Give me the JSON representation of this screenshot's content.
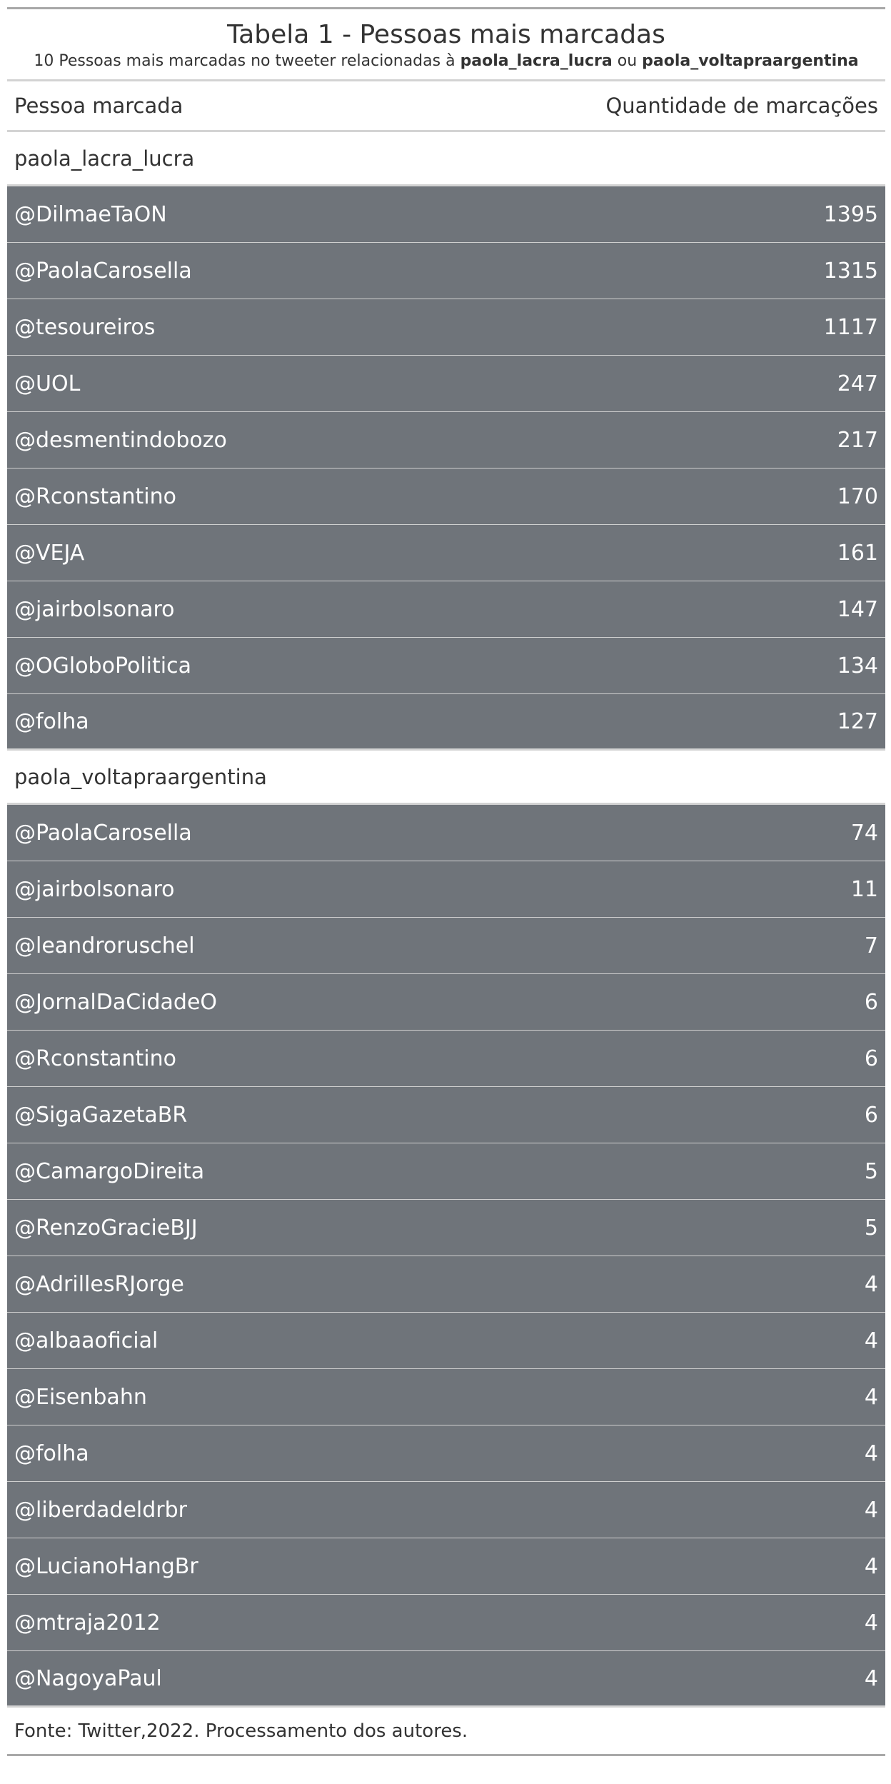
{
  "table": {
    "title": "Tabela 1 - Pessoas mais marcadas",
    "subtitle_prefix": "10 Pessoas mais marcadas no tweeter relacionadas à ",
    "subtitle_bold_1": "paola_lacra_lucra",
    "subtitle_mid": " ou ",
    "subtitle_bold_2": "paola_voltapraargentina",
    "col_person": "Pessoa marcada",
    "col_count": "Quantidade de marcações",
    "source": "Fonte: Twitter,2022. Processamento dos autores."
  },
  "colors": {
    "row_bg": "#6f747a",
    "row_text": "#ffffff",
    "text": "#333333"
  },
  "chart_data": {
    "type": "table",
    "title": "Tabela 1 - Pessoas mais marcadas",
    "columns": [
      "Pessoa marcada",
      "Quantidade de marcações"
    ],
    "groups": [
      {
        "name": "paola_lacra_lucra",
        "rows": [
          {
            "person": "@DilmaeTaON",
            "count": 1395
          },
          {
            "person": "@PaolaCarosella",
            "count": 1315
          },
          {
            "person": "@tesoureiros",
            "count": 1117
          },
          {
            "person": "@UOL",
            "count": 247
          },
          {
            "person": "@desmentindobozo",
            "count": 217
          },
          {
            "person": "@Rconstantino",
            "count": 170
          },
          {
            "person": "@VEJA",
            "count": 161
          },
          {
            "person": "@jairbolsonaro",
            "count": 147
          },
          {
            "person": "@OGloboPolitica",
            "count": 134
          },
          {
            "person": "@folha",
            "count": 127
          }
        ]
      },
      {
        "name": "paola_voltapraargentina",
        "rows": [
          {
            "person": "@PaolaCarosella",
            "count": 74
          },
          {
            "person": "@jairbolsonaro",
            "count": 11
          },
          {
            "person": "@leandroruschel",
            "count": 7
          },
          {
            "person": "@JornalDaCidadeO",
            "count": 6
          },
          {
            "person": "@Rconstantino",
            "count": 6
          },
          {
            "person": "@SigaGazetaBR",
            "count": 6
          },
          {
            "person": "@CamargoDireita",
            "count": 5
          },
          {
            "person": "@RenzoGracieBJJ",
            "count": 5
          },
          {
            "person": "@AdrillesRJorge",
            "count": 4
          },
          {
            "person": "@albaaoficial",
            "count": 4
          },
          {
            "person": "@Eisenbahn",
            "count": 4
          },
          {
            "person": "@folha",
            "count": 4
          },
          {
            "person": "@liberdadeldrbr",
            "count": 4
          },
          {
            "person": "@LucianoHangBr",
            "count": 4
          },
          {
            "person": "@mtraja2012",
            "count": 4
          },
          {
            "person": "@NagoyaPaul",
            "count": 4
          }
        ]
      }
    ]
  }
}
